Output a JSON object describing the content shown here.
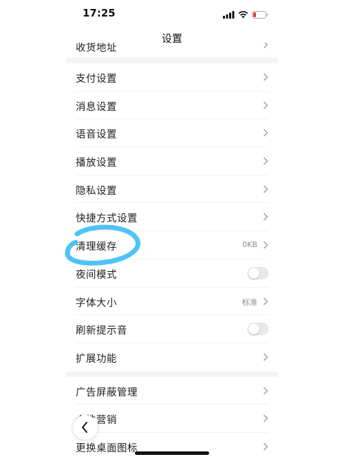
{
  "status_bar": {
    "time": "17:25",
    "icons": [
      "signal-icon",
      "wifi-icon",
      "battery-low-icon"
    ],
    "battery_color": "#e53935"
  },
  "header": {
    "title": "设置"
  },
  "settings": {
    "partial_top": {
      "label": "收货地址"
    },
    "group1": [
      {
        "label": "支付设置",
        "control": "chevron"
      },
      {
        "label": "消息设置",
        "control": "chevron"
      },
      {
        "label": "语音设置",
        "control": "chevron"
      },
      {
        "label": "播放设置",
        "control": "chevron"
      },
      {
        "label": "隐私设置",
        "control": "chevron"
      },
      {
        "label": "快捷方式设置",
        "control": "chevron"
      },
      {
        "label": "清理缓存",
        "control": "chevron",
        "value": "0KB"
      },
      {
        "label": "夜间模式",
        "control": "toggle",
        "on": false
      },
      {
        "label": "字体大小",
        "control": "chevron",
        "value": "标准"
      },
      {
        "label": "刷新提示音",
        "control": "toggle",
        "on": false
      },
      {
        "label": "扩展功能",
        "control": "chevron"
      }
    ],
    "group2": [
      {
        "label": "广告屏蔽管理",
        "control": "chevron"
      },
      {
        "label": "个性营销",
        "control": "chevron"
      },
      {
        "label": "更换桌面图标",
        "control": "chevron"
      }
    ]
  },
  "annotation": {
    "highlight_color": "#4fc3f7"
  },
  "floating_back": {
    "icon": "chevron-left-icon"
  }
}
